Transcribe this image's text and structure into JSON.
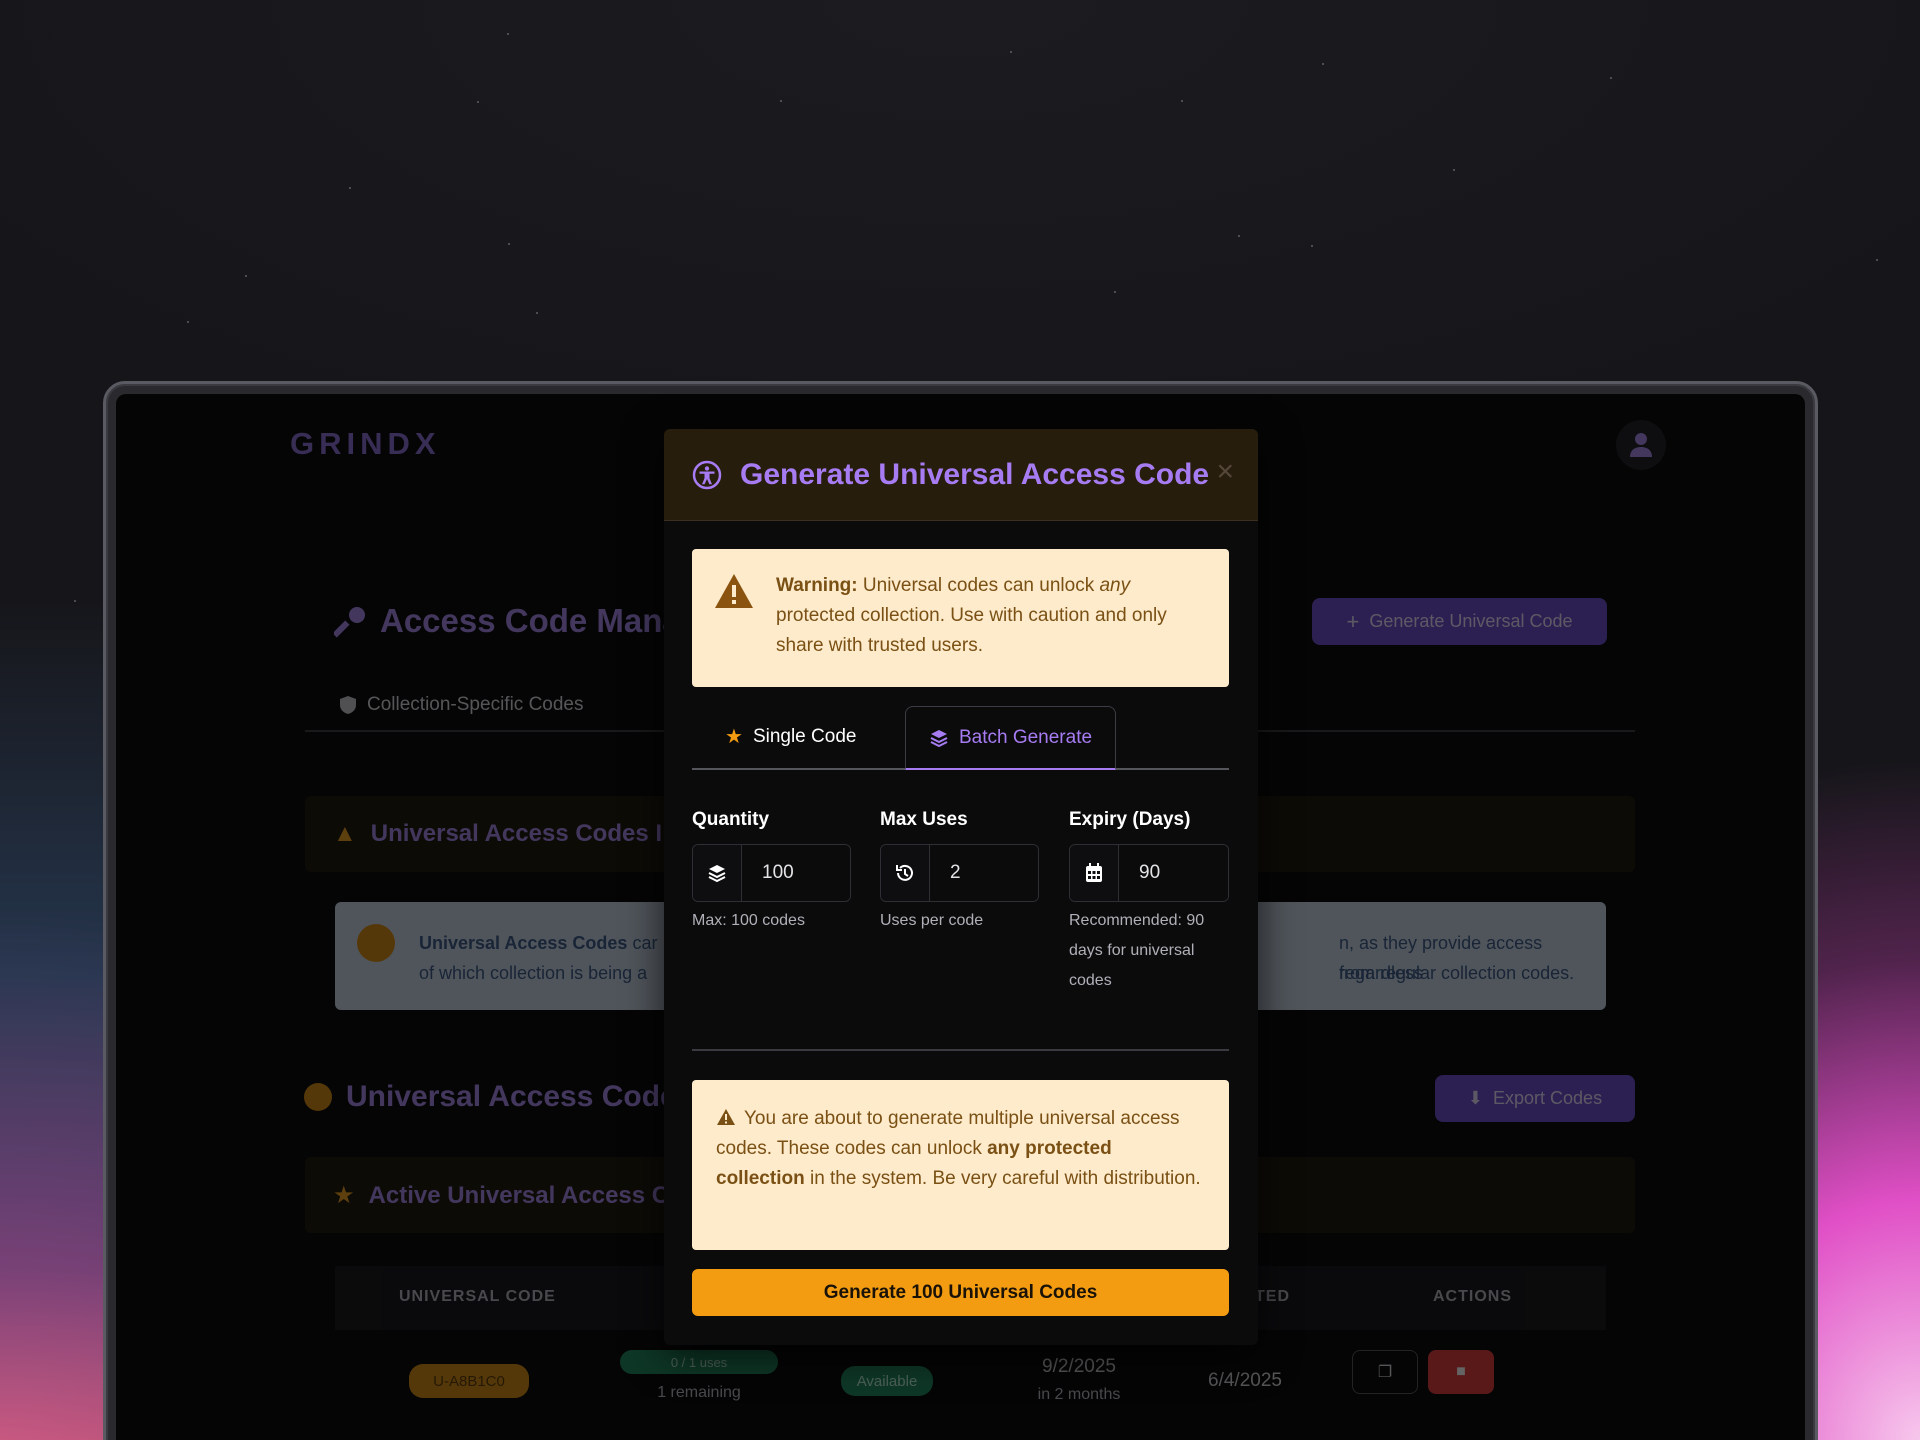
{
  "app": {
    "brand": "GRINDX",
    "page_title": "Access Code Mana",
    "generate_universal_button": "Generate Universal Code",
    "tab_collection_codes": "Collection-Specific Codes",
    "info_panel_title": "Universal Access Codes I",
    "info_text_left_1": "Universal Access Codes",
    "info_text_left_1b": " car",
    "info_text_left_2": "of which collection is being a",
    "info_text_right_1": "n, as they provide access regardless",
    "info_text_right_2": "from regular collection codes.",
    "section_title": "Universal Access Code",
    "export_button": "Export Codes",
    "active_panel_title": "Active Universal Access C",
    "table": {
      "headers": [
        "UNIVERSAL CODE",
        "TED",
        "ACTIONS"
      ],
      "row": {
        "code": "U-A8B1C0",
        "uses": "0 / 1 uses",
        "remaining": "1 remaining",
        "status": "Available",
        "expiry": "9/2/2025",
        "expiry_relative": "in 2 months",
        "created": "6/4/2025"
      }
    }
  },
  "modal": {
    "title": "Generate Universal Access Code",
    "close_label": "×",
    "warning": {
      "bold": "Warning:",
      "text_1": " Universal codes can unlock ",
      "italic": "any",
      "text_2": " protected collection. Use with caution and only share with trusted users."
    },
    "tabs": {
      "single": "Single Code",
      "batch": "Batch Generate"
    },
    "fields": {
      "quantity": {
        "label": "Quantity",
        "value": "100",
        "hint": "Max: 100 codes"
      },
      "max_uses": {
        "label": "Max Uses",
        "value": "2",
        "hint": "Uses per code"
      },
      "expiry": {
        "label": "Expiry (Days)",
        "value": "90",
        "hint": "Recommended: 90 days for universal codes"
      }
    },
    "batch_alert": {
      "text_1": "You are about to generate multiple universal access codes. These codes can unlock ",
      "bold": "any protected collection",
      "text_2": " in the system. Be very careful with distribution."
    },
    "generate_button": "Generate 100 Universal Codes"
  },
  "colors": {
    "accent_purple": "#a77cf3",
    "accent_orange": "#f39c12",
    "alert_bg": "#fdebcc",
    "alert_text": "#7a5014"
  }
}
